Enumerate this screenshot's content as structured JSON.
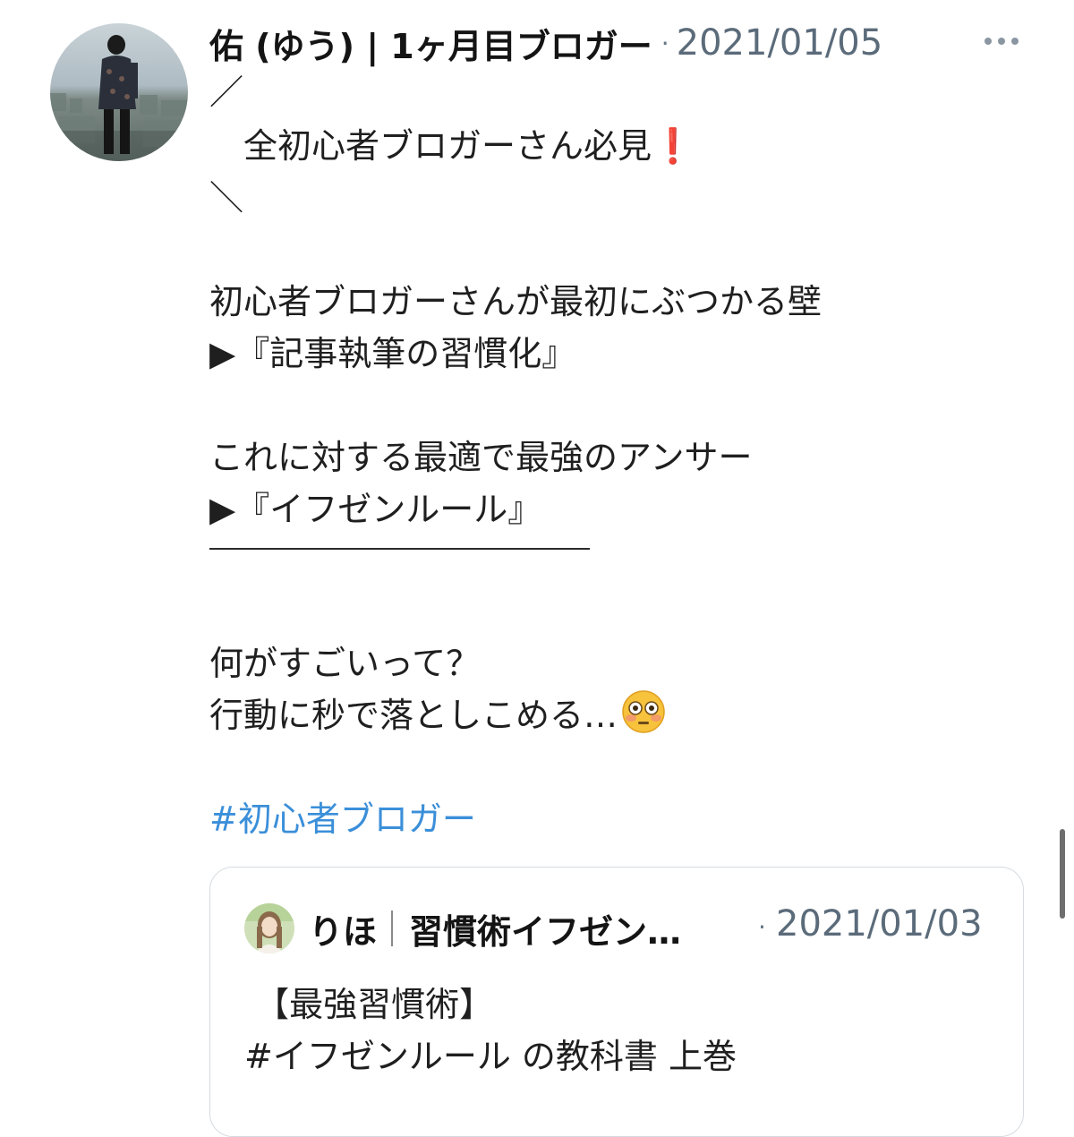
{
  "tweet": {
    "author_name": "佑 (ゆう) | 1ヶ月目ブロガー",
    "separator": "·",
    "timestamp": "2021/01/05",
    "lines": {
      "deco_top": "／",
      "headline": "　全初心者ブロガーさん必見",
      "headline_mark": "❗",
      "deco_bottom": "＼",
      "p1_line1": "初心者ブロガーさんが最初にぶつかる壁",
      "p1_line2": "▶『記事執筆の習慣化』",
      "p2_line1": "これに対する最適で最強のアンサー",
      "p2_line2": "▶『イフゼンルール』",
      "p3_line1": "何がすごいって？",
      "p3_line2": "行動に秒で落としこめる…"
    },
    "hashtag": "#初心者ブロガー",
    "icons": {
      "more": "more-horizontal-icon",
      "emoji": "flushed-face-icon"
    }
  },
  "quoted_tweet": {
    "author_name": "りほ",
    "author_handle": "習慣術イフゼン…",
    "separator": "·",
    "timestamp": "2021/01/03",
    "line1": " 【最強習慣術】",
    "line2": "#イフゼンルール の教科書 上巻"
  },
  "colors": {
    "hashtag": "#3b8fd9",
    "muted": "#5b6b7a",
    "border": "#d6dbe0",
    "exclamation": "#e0262b"
  }
}
